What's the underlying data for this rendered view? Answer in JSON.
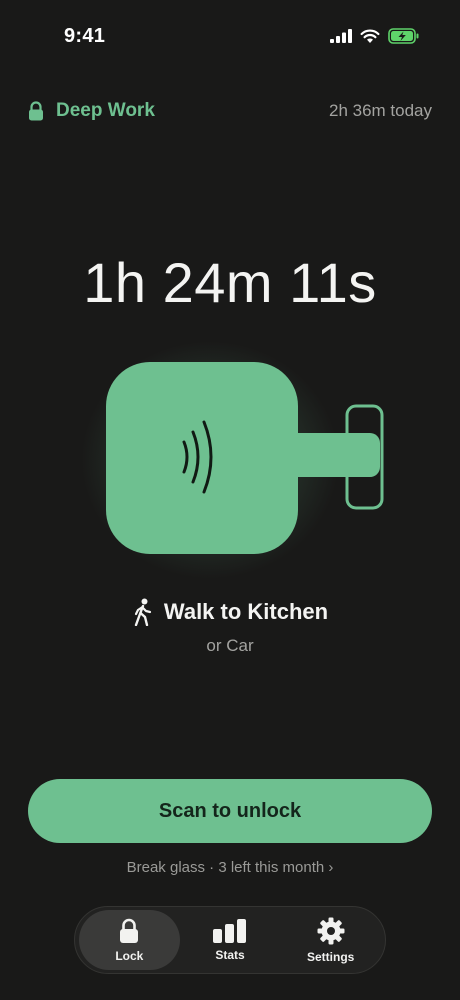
{
  "status_bar": {
    "time": "9:41"
  },
  "header": {
    "mode_label": "Deep Work",
    "today_total": "2h 36m today"
  },
  "timer": {
    "elapsed": "1h 24m 11s"
  },
  "location": {
    "title": "Walk to Kitchen",
    "alternative": "or Car"
  },
  "actions": {
    "scan_label": "Scan to unlock",
    "break_glass_label": "Break glass · 3 left this month ›"
  },
  "tabs": [
    {
      "label": "Lock",
      "icon": "lock-icon",
      "active": true
    },
    {
      "label": "Stats",
      "icon": "bar-chart-icon",
      "active": false
    },
    {
      "label": "Settings",
      "icon": "gear-icon",
      "active": false
    }
  ],
  "colors": {
    "accent": "#6ec090",
    "background": "#191918",
    "battery_charging": "#5fd36a"
  }
}
